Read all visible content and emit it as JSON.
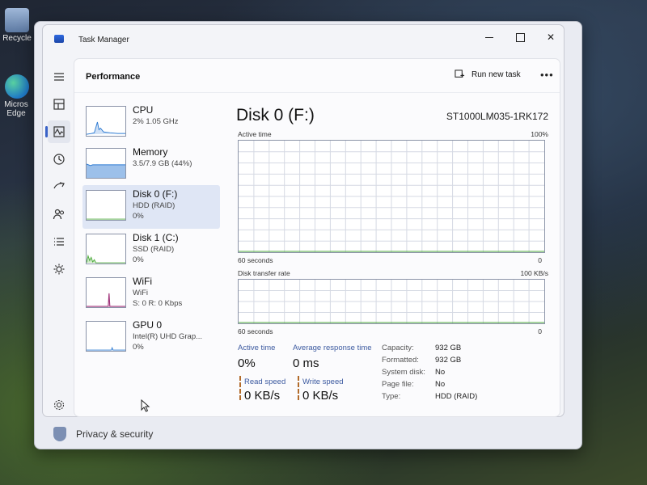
{
  "desktop": {
    "icons": [
      {
        "label": "Recycle"
      },
      {
        "label": "Micros Edge"
      }
    ]
  },
  "settings_window": {
    "bottom_item": "Privacy & security"
  },
  "task_manager": {
    "title": "Task Manager",
    "header": {
      "page_title": "Performance",
      "run_new_task_label": "Run new task",
      "more_label": "•••"
    },
    "rail": [
      {
        "name": "menu-icon"
      },
      {
        "name": "processes-icon"
      },
      {
        "name": "performance-icon",
        "active": true
      },
      {
        "name": "app-history-icon"
      },
      {
        "name": "startup-apps-icon"
      },
      {
        "name": "users-icon"
      },
      {
        "name": "details-icon"
      },
      {
        "name": "services-icon"
      },
      {
        "name": "settings-icon"
      }
    ],
    "devices": [
      {
        "name": "CPU",
        "line2": "2%  1.05 GHz",
        "line3": "",
        "color": "#2f7cd3"
      },
      {
        "name": "Memory",
        "line2": "3.5/7.9 GB (44%)",
        "line3": "",
        "color": "#2f7cd3"
      },
      {
        "name": "Disk 0 (F:)",
        "line2": "HDD (RAID)",
        "line3": "0%",
        "color": "#4caa3c",
        "selected": true
      },
      {
        "name": "Disk 1 (C:)",
        "line2": "SSD (RAID)",
        "line3": "0%",
        "color": "#4caa3c"
      },
      {
        "name": "WiFi",
        "line2": "WiFi",
        "line3": "S: 0  R: 0 Kbps",
        "color": "#a0337a"
      },
      {
        "name": "GPU 0",
        "line2": "Intel(R) UHD Grap...",
        "line3": "0%",
        "color": "#2f7cd3"
      }
    ],
    "detail": {
      "title": "Disk 0 (F:)",
      "model": "ST1000LM035-1RK172",
      "chart1": {
        "label": "Active time",
        "max_label": "100%",
        "x_left": "60 seconds",
        "x_right": "0"
      },
      "chart2": {
        "label": "Disk transfer rate",
        "max_label": "100 KB/s",
        "x_left": "60 seconds",
        "x_right": "0"
      },
      "stats": {
        "active_time_label": "Active time",
        "active_time_value": "0%",
        "avg_response_label": "Average response time",
        "avg_response_value": "0 ms",
        "read_speed_label": "Read speed",
        "read_speed_value": "0 KB/s",
        "write_speed_label": "Write speed",
        "write_speed_value": "0 KB/s"
      },
      "properties": [
        {
          "key": "Capacity:",
          "value": "932 GB"
        },
        {
          "key": "Formatted:",
          "value": "932 GB"
        },
        {
          "key": "System disk:",
          "value": "No"
        },
        {
          "key": "Page file:",
          "value": "No"
        },
        {
          "key": "Type:",
          "value": "HDD (RAID)"
        }
      ]
    }
  }
}
